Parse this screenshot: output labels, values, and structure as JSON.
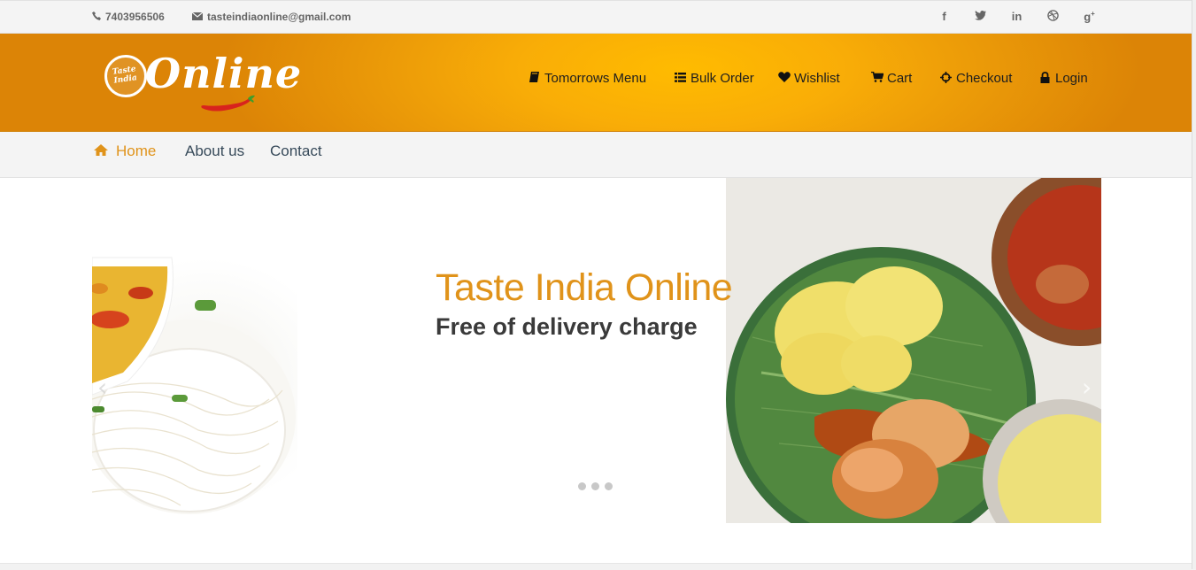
{
  "topbar": {
    "phone": "7403956506",
    "email": "tasteindiaonline@gmail.com",
    "social": [
      {
        "name": "facebook-icon",
        "glyph": "f"
      },
      {
        "name": "twitter-icon",
        "glyph": "🐦"
      },
      {
        "name": "linkedin-icon",
        "glyph": "in"
      },
      {
        "name": "dribbble-icon",
        "glyph": "⊛"
      },
      {
        "name": "google-plus-icon",
        "glyph": "g⁺"
      }
    ]
  },
  "logo": {
    "seal_text": "Taste India",
    "word": "Online"
  },
  "mainnav": [
    {
      "label": "Tomorrows Menu",
      "icon": "book-icon",
      "glyph": "📘"
    },
    {
      "label": "Bulk Order",
      "icon": "list-icon",
      "glyph": "☰"
    },
    {
      "label": "Wishlist",
      "icon": "heart-icon",
      "glyph": "♥"
    },
    {
      "label": "Cart",
      "icon": "cart-icon",
      "glyph": "🛒"
    },
    {
      "label": "Checkout",
      "icon": "crosshairs-icon",
      "glyph": "✥"
    },
    {
      "label": "Login",
      "icon": "lock-icon",
      "glyph": "🔒"
    }
  ],
  "subnav": {
    "home": "Home",
    "about": "About us",
    "contact": "Contact"
  },
  "slider": {
    "title": "Taste India Online",
    "subtitle": "Free of delivery charge",
    "dots": 3,
    "active_dot": 0
  },
  "colors": {
    "accent": "#e0931a",
    "header_orange": "#f9ad07"
  }
}
